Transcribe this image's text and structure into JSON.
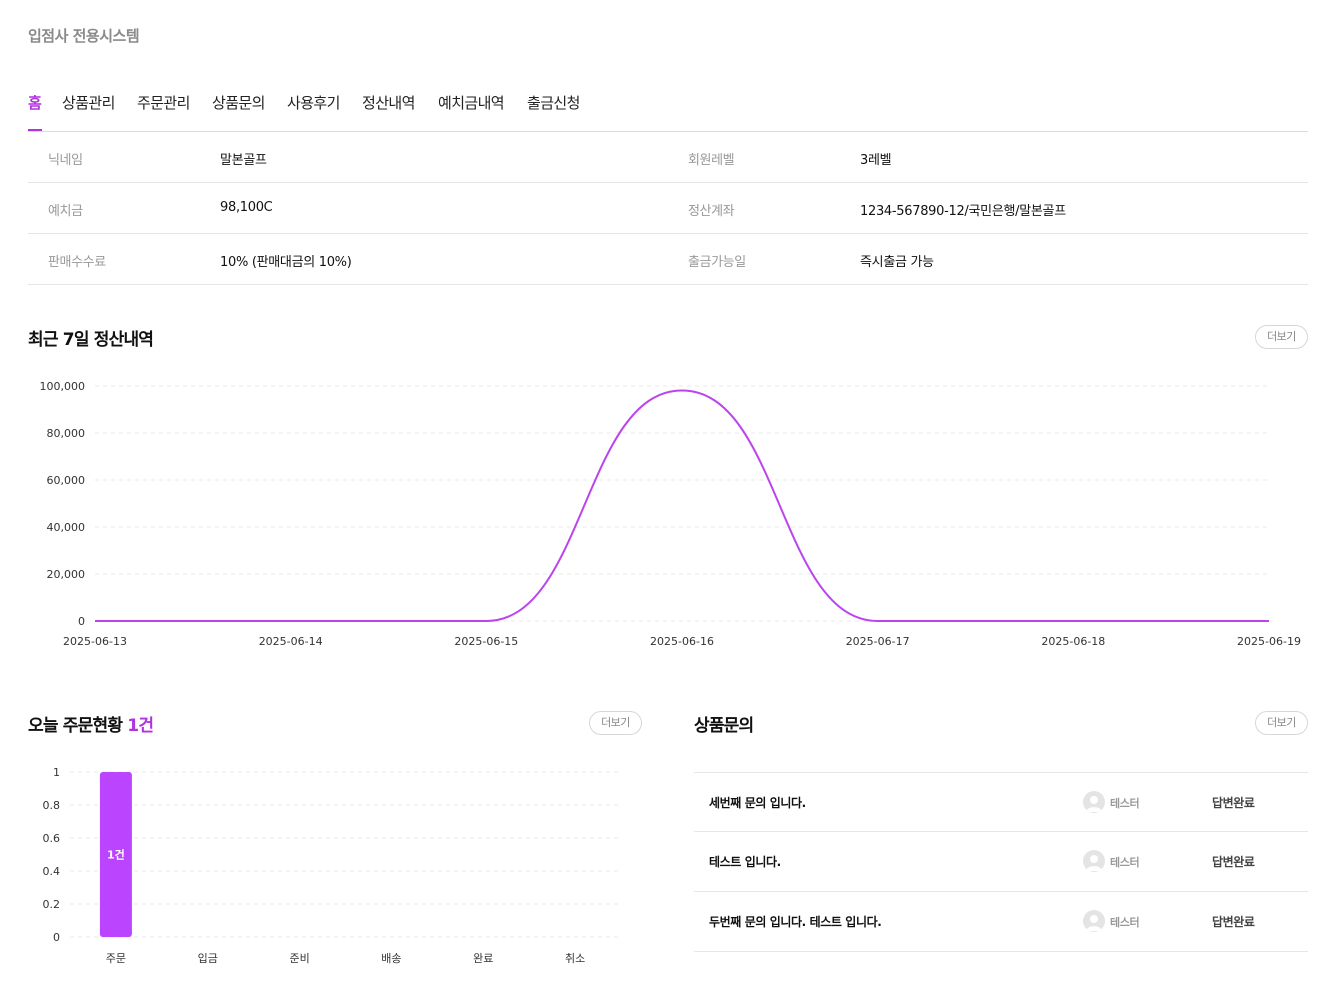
{
  "app": {
    "title": "입점사 전용시스템"
  },
  "colors": {
    "accent": "#b033e0",
    "line": "#bb44ee",
    "bar": "#bb44ff"
  },
  "nav": {
    "tabs": [
      {
        "label": "홈",
        "active": true
      },
      {
        "label": "상품관리"
      },
      {
        "label": "주문관리"
      },
      {
        "label": "상품문의"
      },
      {
        "label": "사용후기"
      },
      {
        "label": "정산내역"
      },
      {
        "label": "예치금내역"
      },
      {
        "label": "출금신청"
      }
    ]
  },
  "info": {
    "nickname_label": "닉네임",
    "nickname": "말본골프",
    "level_label": "회원레벨",
    "level": "3레벨",
    "deposit_label": "예치금",
    "deposit": "98,100C",
    "account_label": "정산계좌",
    "account": "1234-567890-12/국민은행/말본골프",
    "fee_label": "판매수수료",
    "fee": "10% (판매대금의 10%)",
    "withdraw_label": "출금가능일",
    "withdraw": "즉시출금 가능"
  },
  "settlement": {
    "title": "최근 7일 정산내역",
    "more": "더보기",
    "chart_data": {
      "type": "line",
      "x": [
        "2025-06-13",
        "2025-06-14",
        "2025-06-15",
        "2025-06-16",
        "2025-06-17",
        "2025-06-18",
        "2025-06-19"
      ],
      "values": [
        0,
        0,
        0,
        98100,
        0,
        0,
        0
      ],
      "yticks": [
        0,
        20000,
        40000,
        60000,
        80000,
        100000
      ],
      "ytick_labels": [
        "0",
        "20,000",
        "40,000",
        "60,000",
        "80,000",
        "100,000"
      ],
      "ylim": [
        0,
        100000
      ],
      "grid": true
    }
  },
  "orders": {
    "title": "오늘 주문현황",
    "count": "1건",
    "more": "더보기",
    "chart_data": {
      "type": "bar",
      "categories": [
        "주문",
        "입금",
        "준비",
        "배송",
        "완료",
        "취소"
      ],
      "values": [
        1,
        0,
        0,
        0,
        0,
        0
      ],
      "data_labels": [
        "1건",
        "",
        "",
        "",
        "",
        ""
      ],
      "yticks": [
        0,
        0.2,
        0.4,
        0.6,
        0.8,
        1
      ],
      "ytick_labels": [
        "0",
        "0.2",
        "0.4",
        "0.6",
        "0.8",
        "1"
      ],
      "ylim": [
        0,
        1
      ],
      "grid": true
    }
  },
  "inquiries": {
    "title": "상품문의",
    "more": "더보기",
    "items": [
      {
        "title": "세번째 문의 입니다.",
        "author": "테스터",
        "status": "답변완료"
      },
      {
        "title": "테스트 입니다.",
        "author": "테스터",
        "status": "답변완료"
      },
      {
        "title": "두번째 문의 입니다. 테스트 입니다.",
        "author": "테스터",
        "status": "답변완료"
      }
    ]
  }
}
